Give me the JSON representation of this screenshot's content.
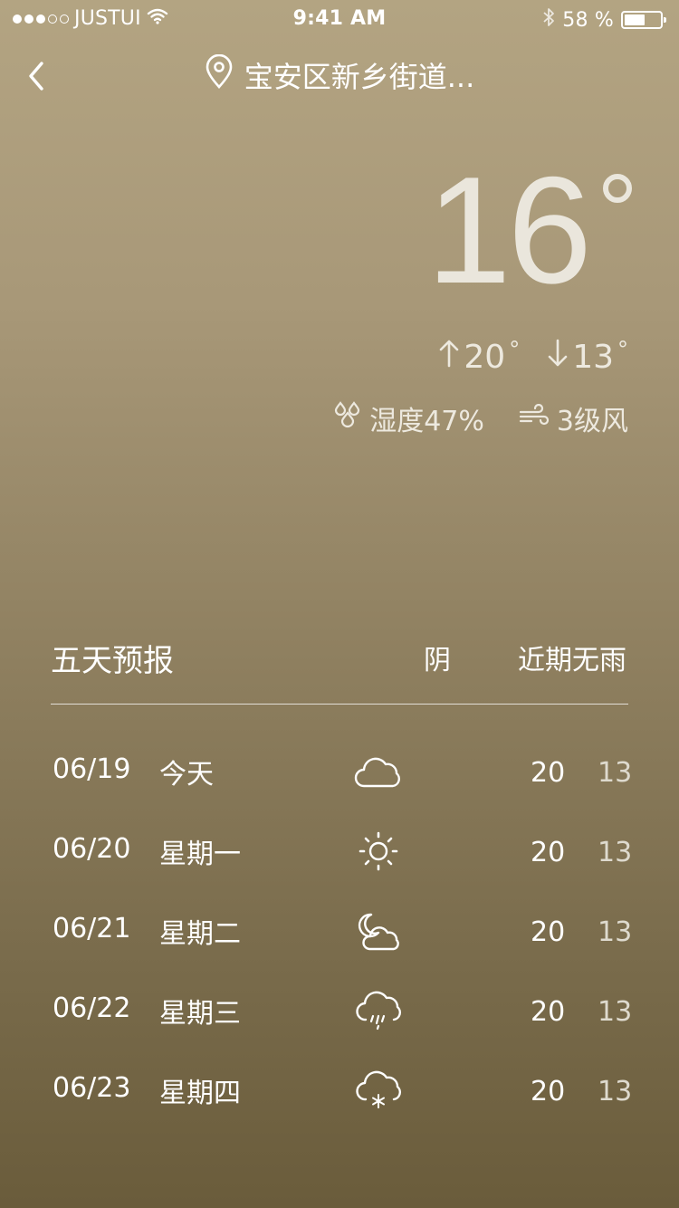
{
  "status_bar": {
    "carrier": "JUSTUI",
    "time": "9:41 AM",
    "battery_text": "58 %",
    "battery_level": 0.58
  },
  "nav": {
    "location": "宝安区新乡街道..."
  },
  "current": {
    "temperature": "16",
    "high": "20",
    "low": "13",
    "humidity": "湿度47%",
    "wind": "3级风"
  },
  "forecast": {
    "title": "五天预报",
    "condition": "阴",
    "note": "近期无雨",
    "days": [
      {
        "date": "06/19",
        "day": "今天",
        "icon": "cloud-icon",
        "high": "20",
        "low": "13"
      },
      {
        "date": "06/20",
        "day": "星期一",
        "icon": "sun-icon",
        "high": "20",
        "low": "13"
      },
      {
        "date": "06/21",
        "day": "星期二",
        "icon": "moon-cloud-icon",
        "high": "20",
        "low": "13"
      },
      {
        "date": "06/22",
        "day": "星期三",
        "icon": "rain-cloud-icon",
        "high": "20",
        "low": "13"
      },
      {
        "date": "06/23",
        "day": "星期四",
        "icon": "snow-cloud-icon",
        "high": "20",
        "low": "13"
      }
    ]
  }
}
